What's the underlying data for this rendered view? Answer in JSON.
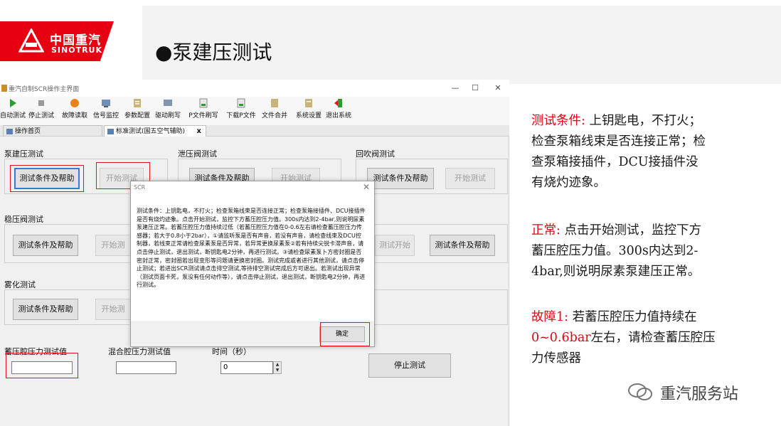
{
  "header": {
    "logo_cn": "中国重汽",
    "logo_en": "SINOTRUK",
    "title": "●泵建压测试"
  },
  "window": {
    "title": "重汽自制SCR操作主界面",
    "controls": {
      "minimize": "—",
      "maximize": "☐",
      "close": "✕"
    },
    "toolbar": [
      "自动测试",
      "停止测试",
      "故障读取",
      "信号监控",
      "参数配置",
      "驱动刷写",
      "P文件刷写",
      "下载P文件",
      "文件合并",
      "系统设置",
      "退出系统"
    ],
    "tabs": [
      {
        "label": "操作首页",
        "active": false
      },
      {
        "label": "标准测试(国五空气辅助)",
        "active": true,
        "close": "x"
      }
    ],
    "groups": {
      "pump": {
        "label": "泵建压测试",
        "help": "测试条件及帮助",
        "start": "开始测试"
      },
      "relief": {
        "label": "泄压阀测试",
        "help": "测试条件及帮助",
        "start": "开始测试"
      },
      "blowback": {
        "label": "回吹阀测试",
        "help": "测试条件及帮助",
        "start": "开始测试"
      },
      "stable": {
        "label": "稳压阀测试",
        "help": "测试条件及帮助",
        "start": "开始测",
        "start2": "测试开始",
        "help2": "测试条件及帮助"
      },
      "atomize": {
        "label": "雾化测试",
        "help": "测试条件及帮助",
        "start": "开始测"
      }
    },
    "fields": {
      "accum_label": "蓄压腔压力测试值",
      "mix_label": "混合腔压力测试值",
      "time_label": "时间（秒）",
      "time_value": "0",
      "spin_up": "▲",
      "spin_down": "▼",
      "stop_button": "停止测试"
    },
    "dialog": {
      "title": "SCR",
      "close": "✕",
      "body": "测试条件：上钥匙电，不打火；检查泵箱线束是否连接正常；检查泵箱接插件、DCU接插件是否有烧灼迹象。点击开始测试，监控下方蓄压腔压力值。300s内达到2-4bar,则说明尿素泵建压正常。若蓄压腔压力值持续过低（若蓄压腔压力值在0-0.6左右请检查蓄压腔压力传感器；若大于0.8小于2bar），①请监听泵是否有声音，若没有声音，请检查线束及DCU控制器，若线束正常请检查尿素泵是否异常，若异常更换尿素泵②若有持续尖锐卡滞声音，请点击停止测试，退出测试，断钥匙电2分钟，再进行测试。③请检查尿素泵卜方密封圈是否密封正常，密封圈若出现变形等问题请更换密封圈。测试完成或者进行其他测试，请点击停止测试；若进出SCR测试请点击排空测试,等待排空测试完成后方可退出。若测试出现异常（测试页面卡死，泵没有任何动作等），请点击停止测试，退出测试，断钥匙电2分钟，再进行测试。",
      "ok": "确定"
    }
  },
  "notes": {
    "cond_label": "测试条件:",
    "cond_text_1": "上钥匙电，不打火；",
    "cond_text_2": "检查泵箱线束是否连接正常；检",
    "cond_text_3": "查泵箱接插件，DCU接插件没",
    "cond_text_4": "有烧灼迹象。",
    "normal_label": "正常:",
    "normal_text_1": "点击开始测试，监控下方",
    "normal_text_2": "蓄压腔压力值。300s内达到2-",
    "normal_text_3": "4bar,则说明尿素泵建压正常。",
    "fault_label": "故障1:",
    "fault_text_1": "若蓄压腔压力值持续在",
    "fault_text_2a": "0~0.6bar",
    "fault_text_2b": "左右，请检查蓄压腔压",
    "fault_text_3": "力传感器"
  },
  "watermark": "重汽服务站",
  "colors": {
    "brand_red": "#e60012",
    "focus_blue": "#3a78d8"
  }
}
